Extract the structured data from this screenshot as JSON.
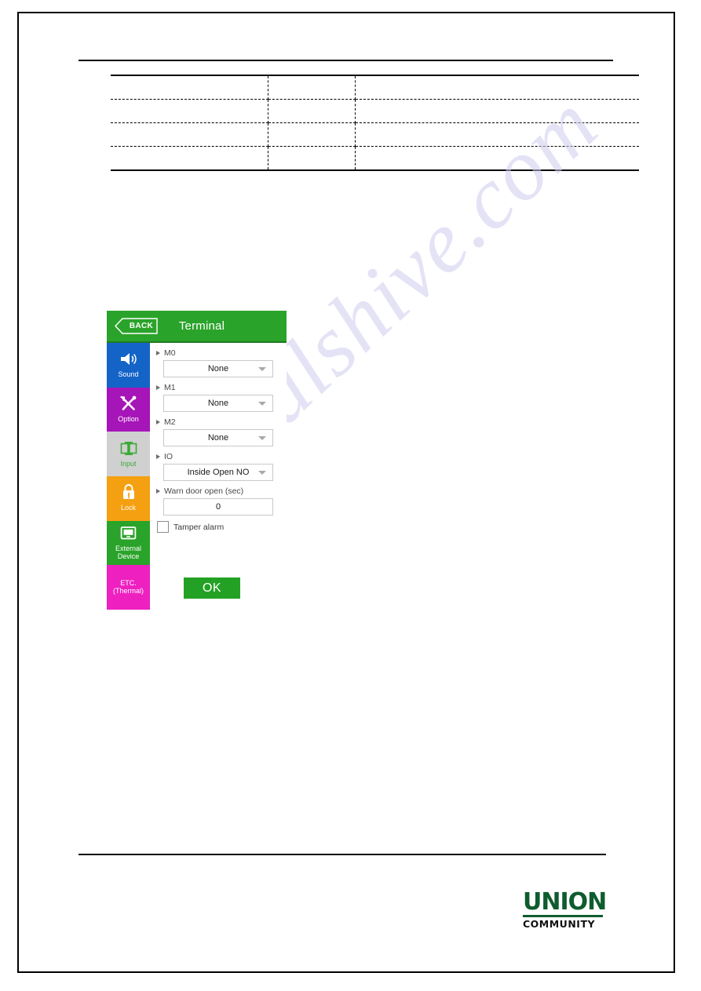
{
  "document": {
    "table": {
      "columns": [
        "",
        "",
        ""
      ],
      "rows": [
        [
          "",
          "",
          ""
        ],
        [
          "",
          "",
          ""
        ],
        [
          "",
          "",
          ""
        ],
        [
          "",
          "",
          ""
        ]
      ]
    },
    "watermark": "manualshive.com",
    "logo": {
      "mark": "UNION",
      "subtitle": "COMMUNITY"
    }
  },
  "terminal": {
    "header": {
      "back_label": "BACK",
      "title": "Terminal"
    },
    "sidebar": {
      "items": [
        {
          "label": "Sound",
          "icon": "speaker-icon",
          "bg": "#1464c8",
          "selected": false
        },
        {
          "label": "Option",
          "icon": "tools-icon",
          "bg": "#a615b8",
          "selected": false
        },
        {
          "label": "Input",
          "icon": "input-icon",
          "bg": "#d0d0d0",
          "selected": true
        },
        {
          "label": "Lock",
          "icon": "padlock-icon",
          "bg": "#f5a011",
          "selected": false
        },
        {
          "label": "External\nDevice",
          "icon": "monitor-icon",
          "bg": "#2aa32a",
          "selected": false
        },
        {
          "label": "ETC.\n(Thermal)",
          "icon": "none",
          "bg": "#ee20c0",
          "selected": false
        }
      ]
    },
    "fields": [
      {
        "label": "M0",
        "type": "select",
        "value": "None"
      },
      {
        "label": "M1",
        "type": "select",
        "value": "None"
      },
      {
        "label": "M2",
        "type": "select",
        "value": "None"
      },
      {
        "label": "IO",
        "type": "select",
        "value": "Inside Open NO"
      },
      {
        "label": "Warn door open (sec)",
        "type": "number",
        "value": "0"
      }
    ],
    "tamper_alarm": {
      "label": "Tamper alarm",
      "checked": false
    },
    "ok_button": {
      "label": "OK"
    },
    "colors": {
      "header_green": "#2aa32a",
      "ok_green": "#23a124",
      "selected_text": "#3aaa35",
      "panel_gray": "#d8d8d8"
    }
  }
}
